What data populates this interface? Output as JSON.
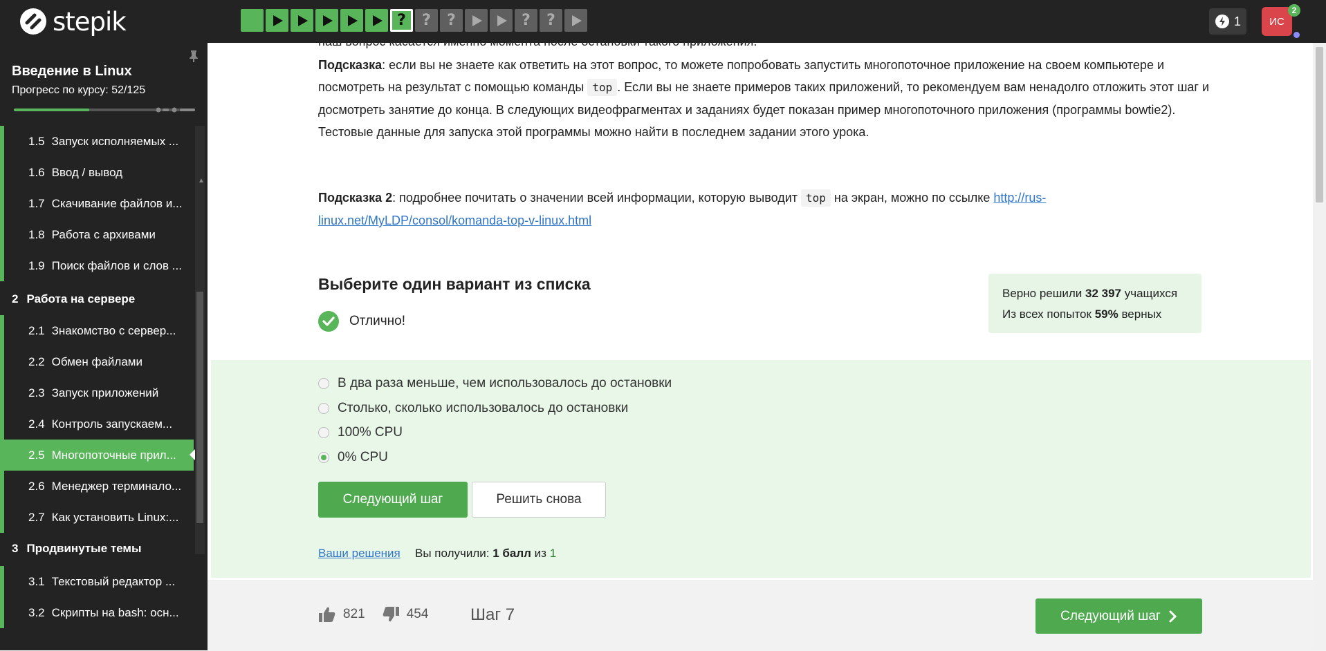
{
  "header": {
    "logo_text": "stepik",
    "energy_count": "1",
    "avatar_initials": "ИС",
    "notification_count": "2",
    "steps": [
      {
        "state": "done",
        "icon": "theory"
      },
      {
        "state": "done",
        "icon": "video"
      },
      {
        "state": "done",
        "icon": "video"
      },
      {
        "state": "done",
        "icon": "video"
      },
      {
        "state": "done",
        "icon": "video"
      },
      {
        "state": "done",
        "icon": "video"
      },
      {
        "state": "done-current",
        "icon": "question"
      },
      {
        "state": "todo",
        "icon": "question"
      },
      {
        "state": "todo",
        "icon": "question"
      },
      {
        "state": "todo",
        "icon": "video"
      },
      {
        "state": "todo",
        "icon": "video"
      },
      {
        "state": "todo",
        "icon": "question"
      },
      {
        "state": "todo",
        "icon": "question"
      },
      {
        "state": "todo",
        "icon": "video"
      }
    ]
  },
  "sidebar": {
    "course_title": "Введение в Linux",
    "progress_label": "Прогресс по курсу:",
    "progress_value": "52/125",
    "progress_fraction": 0.416,
    "items": [
      {
        "type": "lesson",
        "num": "1.5",
        "label": "Запуск исполняемых ..."
      },
      {
        "type": "lesson",
        "num": "1.6",
        "label": "Ввод / вывод"
      },
      {
        "type": "lesson",
        "num": "1.7",
        "label": "Скачивание файлов и..."
      },
      {
        "type": "lesson",
        "num": "1.8",
        "label": "Работа с архивами"
      },
      {
        "type": "lesson",
        "num": "1.9",
        "label": "Поиск файлов и слов ..."
      },
      {
        "type": "section",
        "num": "2",
        "label": "Работа на сервере"
      },
      {
        "type": "lesson",
        "num": "2.1",
        "label": "Знакомство с сервер..."
      },
      {
        "type": "lesson",
        "num": "2.2",
        "label": "Обмен файлами"
      },
      {
        "type": "lesson",
        "num": "2.3",
        "label": "Запуск приложений"
      },
      {
        "type": "lesson",
        "num": "2.4",
        "label": "Контроль запускаем..."
      },
      {
        "type": "lesson",
        "num": "2.5",
        "label": "Многопоточные прил...",
        "active": true
      },
      {
        "type": "lesson",
        "num": "2.6",
        "label": "Менеджер терминало..."
      },
      {
        "type": "lesson",
        "num": "2.7",
        "label": "Как установить Linux:..."
      },
      {
        "type": "section",
        "num": "3",
        "label": "Продвинутые темы"
      },
      {
        "type": "lesson",
        "num": "3.1",
        "label": "Текстовый редактор ..."
      },
      {
        "type": "lesson",
        "num": "3.2",
        "label": "Скрипты на bash: осн..."
      }
    ]
  },
  "content": {
    "cut_line": "наш вопрос касается именно момента после остановки такого приложения.",
    "hint1_label": "Подсказка",
    "hint1_part1": ": если вы не знаете как ответить на этот вопрос, то можете попробовать запустить многопоточное приложение на своем компьютере и посмотреть на результат с помощью команды ",
    "hint1_code": "top",
    "hint1_part2": ". Если вы не знаете примеров таких приложений, то рекомендуем вам ненадолго отложить этот шаг и досмотреть занятие до конца. В следующих видеофрагментах и заданиях будет показан пример многопоточного приложения (программы bowtie2). Тестовые данные для запуска этой программы можно найти в последнем задании этого урока.",
    "hint2_label": "Подсказка 2",
    "hint2_part1": ": подробнее почитать о значении всей информации, которую выводит ",
    "hint2_code": "top",
    "hint2_part2": " на экран, можно по ссылке ",
    "hint2_link": "http://rus-linux.net/MyLDP/consol/komanda-top-v-linux.html",
    "choose_title": "Выберите один вариант из списка",
    "correct_text": "Отлично!",
    "stats_line1_prefix": "Верно решили ",
    "stats_line1_value": "32 397",
    "stats_line1_suffix": " учащихся",
    "stats_line2_prefix": "Из всех попыток ",
    "stats_line2_value": "59%",
    "stats_line2_suffix": " верных",
    "options": [
      {
        "label": "В два раза меньше, чем использовалось до остановки",
        "checked": false
      },
      {
        "label": "Столько, сколько использовалось до остановки",
        "checked": false
      },
      {
        "label": "100% CPU",
        "checked": false
      },
      {
        "label": "0% CPU",
        "checked": true
      }
    ],
    "next_step_button": "Следующий шаг",
    "retry_button": "Решить снова",
    "solutions_link": "Ваши решения",
    "score_prefix": "Вы получили: ",
    "score_bold": "1 балл",
    "score_mid": " из ",
    "score_max": "1"
  },
  "footer": {
    "likes": "821",
    "dislikes": "454",
    "step_label": "Шаг 7",
    "next_button": "Следующий шаг"
  },
  "colors": {
    "accent": "#59b55a",
    "button_green": "#4fa94f",
    "topbar": "#232323",
    "quiz_bg": "#e8f7e8",
    "link": "#2f76c8",
    "avatar": "#d9454a"
  }
}
